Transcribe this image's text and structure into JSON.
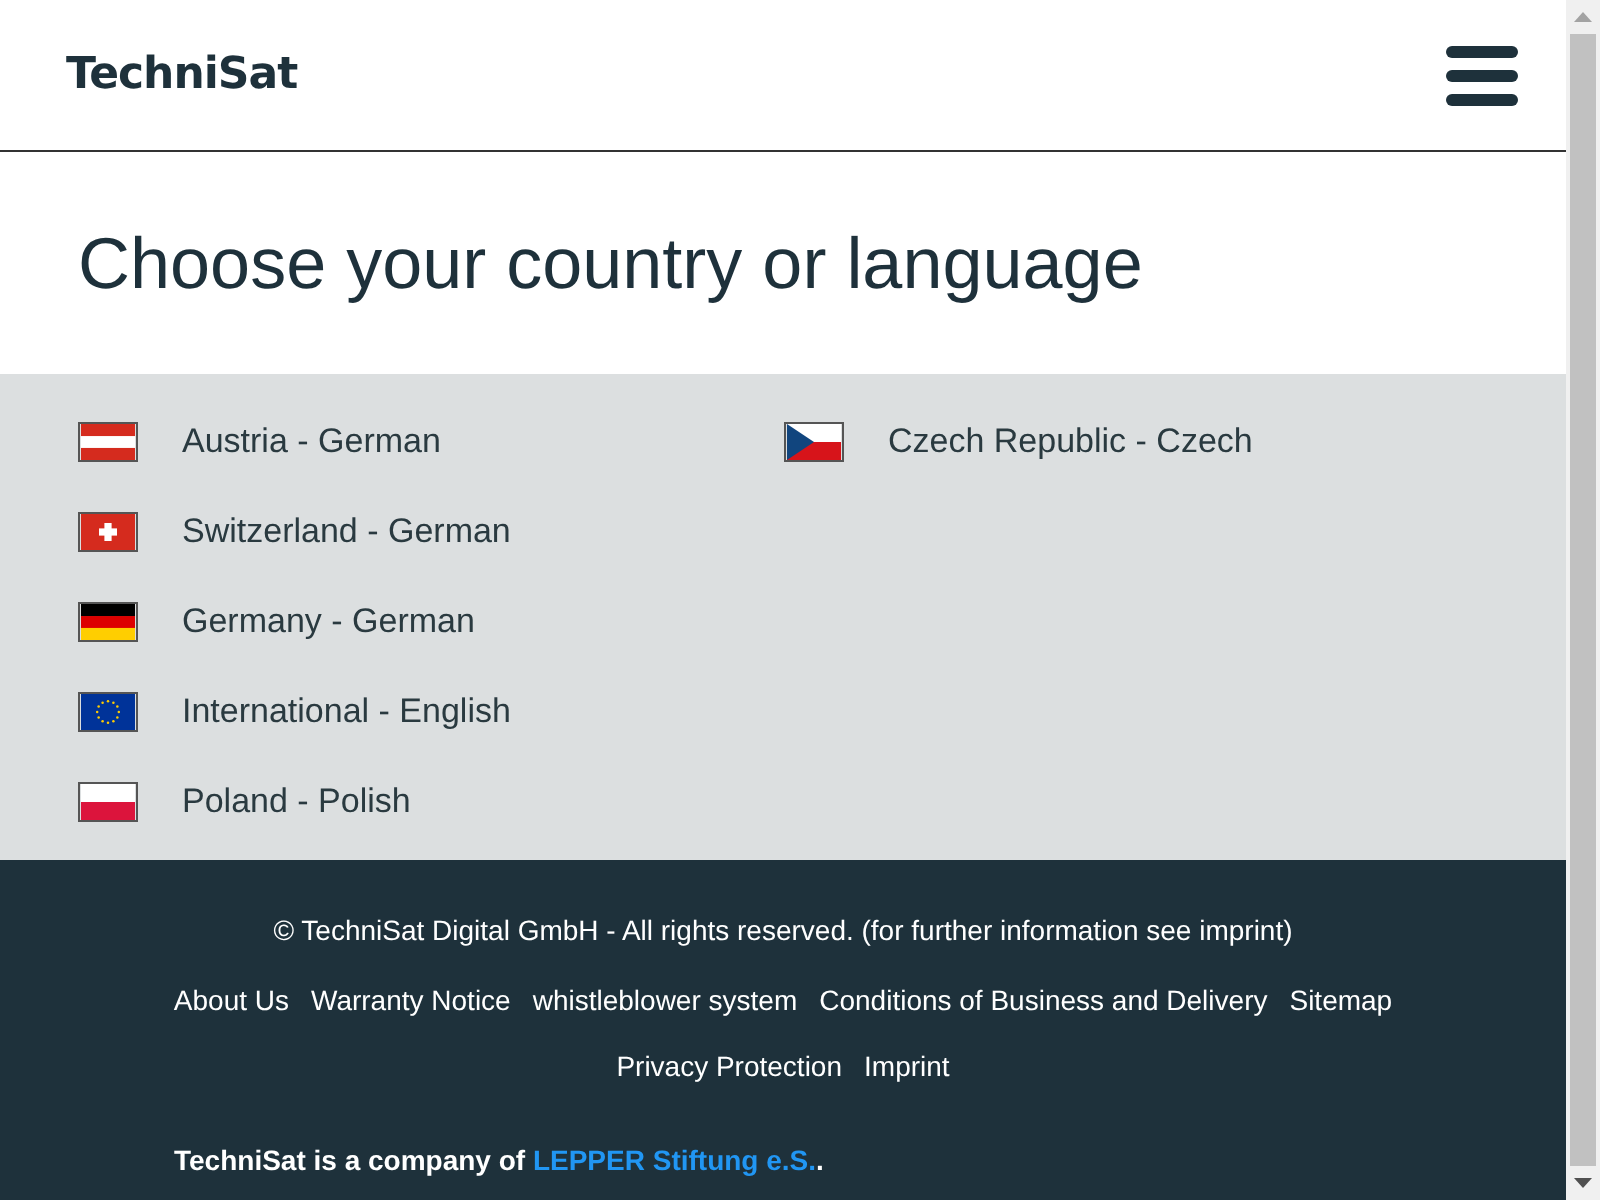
{
  "header": {
    "logo": "TechniSat"
  },
  "heading": "Choose your country or language",
  "columns": [
    [
      {
        "kind": "austria",
        "label": "Austria - German"
      },
      {
        "kind": "switzerland",
        "label": "Switzerland - German"
      },
      {
        "kind": "germany",
        "label": "Germany - German"
      },
      {
        "kind": "eu",
        "label": "International - English"
      },
      {
        "kind": "poland",
        "label": "Poland - Polish"
      }
    ],
    [
      {
        "kind": "czech",
        "label": "Czech Republic - Czech"
      }
    ]
  ],
  "footer": {
    "copyright": "© TechniSat Digital GmbH  - All rights reserved. (for further information see imprint)",
    "links": [
      "About Us",
      "Warranty Notice",
      "whistleblower system",
      "Conditions of Business and Delivery",
      "Sitemap",
      "Privacy Protection",
      "Imprint"
    ],
    "company_note": {
      "text": "TechniSat is a company of ",
      "link": "LEPPER Stiftung e.S.",
      "suffix": "."
    }
  }
}
